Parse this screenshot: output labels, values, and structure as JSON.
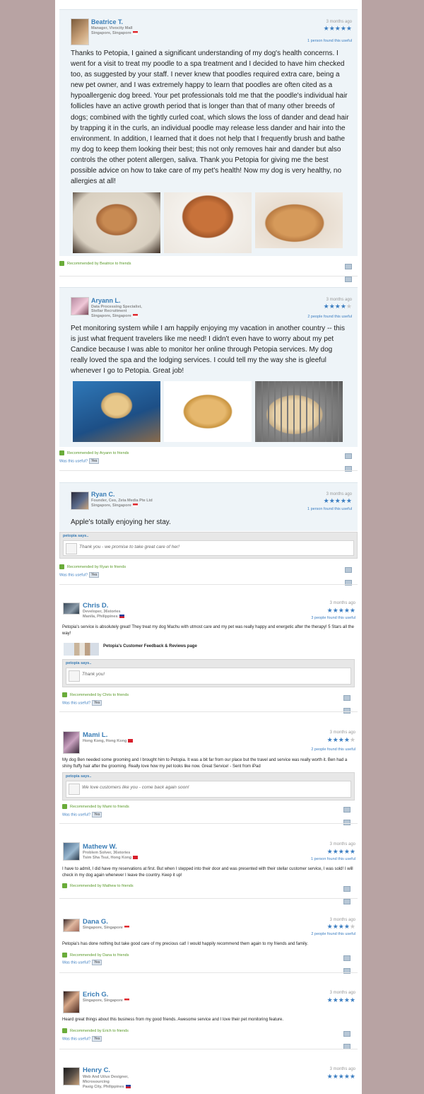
{
  "reviews": [
    {
      "name": "Beatrice T.",
      "title": "Manager, Vivocity Mall",
      "location": "Singapore, Singapore",
      "time": "3 months ago",
      "rating": 5,
      "found_useful": "1 person found this useful",
      "body": "Thanks to Petopia, I gained a significant understanding of my dog's health concerns. I went for a visit to treat my poodle to a spa treatment and I decided to have him checked too, as suggested by your staff. I never knew that poodles required extra care, being a new pet owner, and I was extremely happy to learn that poodles are often cited as a hypoallergenic dog breed. Your pet professionals told me that the poodle's individual hair follicles have an active growth period that is longer than that of many other breeds of dogs; combined with the tightly curled coat, which slows the loss of dander and dead hair by trapping it in the curls, an individual poodle may release less dander and hair into the environment. In addition, I learned that it does not help that I frequently brush and bathe my dog to keep them looking their best; this not only removes hair and dander but also controls the other potent allergen, saliva. Thank you Petopia for giving me the best possible advice on how to take care of my pet's health! Now my dog is very healthy, no allergies at all!",
      "recommended": "Recommended by Beatrice to friends"
    },
    {
      "name": "Aryann L.",
      "title": "Data Processing Specialist,",
      "title2": "Stellar Recruitment",
      "location": "Singapore, Singapore",
      "time": "3 months ago",
      "rating": 4,
      "found_useful": "2 people found this useful",
      "body": "Pet monitoring system while I am happily enjoying my vacation in another country -- this is just what frequent travelers like me need! I didn't even have to worry about my pet Candice because I was able to monitor her online through Petopia services. My dog really loved the spa and the lodging services. I could tell my the way she is gleeful whenever I go to Petopia. Great job!",
      "recommended": "Recommended by Aryann to friends",
      "was_useful": "Was this useful?",
      "yes": "Yes"
    },
    {
      "name": "Ryan C.",
      "title": "Founder, Ceo, Zeta Media Pte Ltd",
      "location": "Singapore, Singapore",
      "time": "3 months ago",
      "rating": 5,
      "found_useful": "1 person found this useful",
      "body": "Apple's totally enjoying her stay.",
      "response_header": "petopia says..",
      "response": "Thank you - we promise to take great care of her!",
      "recommended": "Recommended by Ryan to friends",
      "was_useful": "Was this useful?",
      "yes": "Yes"
    },
    {
      "name": "Chris D.",
      "title": "Developer, 36stories",
      "location": "Manila, Philippines",
      "time": "3 months ago",
      "rating": 5,
      "found_useful": "3 people found this useful",
      "body": "Petopia's service is absolutely great! They treat my dog Machu with utmost care and my pet was really happy and energetic after the therapy! 5 Stars all the way!",
      "link_title": "Petopia's Customer Feedback & Reviews page",
      "response_header": "petopia says..",
      "response": "Thank you!",
      "recommended": "Recommended by Chris to friends",
      "was_useful": "Was this useful?",
      "yes": "Yes"
    },
    {
      "name": "Mami L.",
      "location": "Hong Kong, Hong Kong",
      "time": "3 months ago",
      "rating": 4,
      "found_useful": "2 people found this useful",
      "body": "My dog Ben needed some grooming and I brought him to Petopia. It was a bit far from our place but the travel and service was really worth it. Ben had a shiny fluffy hair after the grooming. Really love how my pet looks like now. Great Service! - Sent from iPad",
      "response_header": "petopia says..",
      "response": "We love customers like you - come back again soon!",
      "recommended": "Recommended by Mami to friends",
      "was_useful": "Was this useful?",
      "yes": "Yes"
    },
    {
      "name": "Mathew W.",
      "title": "Problem Solver, 36stories",
      "location": "Tsim Sha Tsui, Hong Kong",
      "time": "3 months ago",
      "rating": 5,
      "found_useful": "1 person found this useful",
      "body": "I have to admit, I did have my reservations at first. But when I stepped into their door and was presented with their stellar customer service, I was sold! I will check in my dog again whenever I leave the country. Keep it up!",
      "recommended": "Recommended by Mathew to friends"
    },
    {
      "name": "Dana G.",
      "location": "Singapore, Singapore",
      "time": "3 months ago",
      "rating": 4,
      "found_useful": "2 people found this useful",
      "body": "Petopia's has done nothing but take good care of my precious cat! I would happily recommend them again to my friends and family.",
      "recommended": "Recommended by Dana to friends",
      "was_useful": "Was this useful?",
      "yes": "Yes"
    },
    {
      "name": "Erich G.",
      "location": "Singapore, Singapore",
      "time": "3 months ago",
      "rating": 5,
      "body": "Heard great things about this business from my good friends. Awesome service and I love their pet monitoring feature.",
      "recommended": "Recommended by Erich to friends",
      "was_useful": "Was this useful?",
      "yes": "Yes"
    },
    {
      "name": "Henry C.",
      "title": "Web And Ui/ux Designer,",
      "title2": "Microsourcing",
      "location": "Pasig City, Philippines",
      "time": "3 months ago",
      "rating": 5
    }
  ],
  "colors": {
    "background": "#b8a3a3",
    "accent": "#3a7db6",
    "star": "#3c7ec1",
    "recommend": "#5a9a2a",
    "card": "#eef4f8"
  },
  "icons": [
    "star-icon",
    "thumbs-up-icon",
    "share-icon",
    "flag-icon"
  ]
}
